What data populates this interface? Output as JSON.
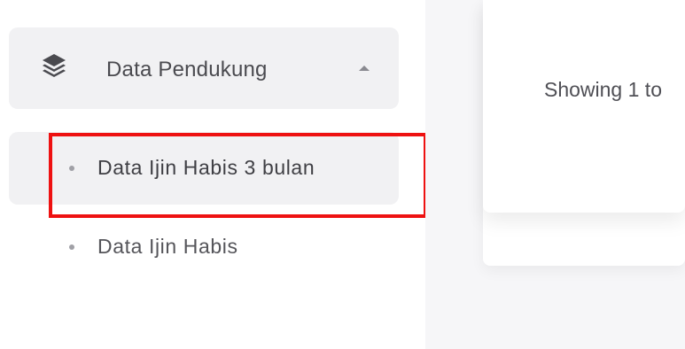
{
  "sidebar": {
    "parent": {
      "label": "Data Pendukung",
      "icon": "layers-icon",
      "caret": "caret-up-icon"
    },
    "items": [
      {
        "label": "Data Ijin Habis 3 bulan",
        "active": true
      },
      {
        "label": "Data Ijin Habis",
        "active": false
      }
    ]
  },
  "main": {
    "table_info": "Showing 1 to"
  },
  "colors": {
    "highlight": "#ee1111",
    "menu_bg": "#f1f1f3",
    "main_bg": "#f6f6f8"
  }
}
